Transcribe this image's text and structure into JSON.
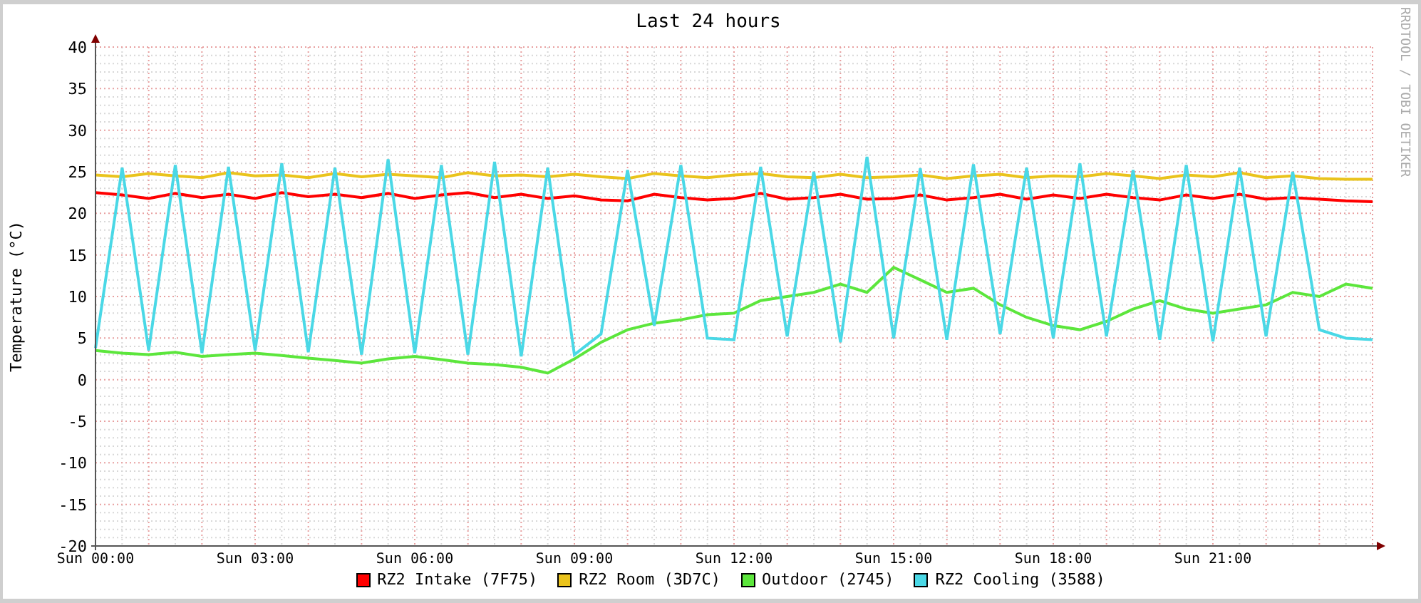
{
  "graph": {
    "credit": "RRDTOOL / TOBI OETIKER",
    "chart_data": {
      "type": "line",
      "grid": true,
      "title": "Last 24 hours",
      "ylabel": "Temperature (°C)",
      "ylim": [
        -20,
        40
      ],
      "yticks": [
        -20,
        -15,
        -10,
        -5,
        0,
        5,
        10,
        15,
        20,
        25,
        30,
        35,
        40
      ],
      "categories": [
        "Sun 00:00",
        null,
        null,
        null,
        null,
        null,
        "Sun 03:00",
        null,
        null,
        null,
        null,
        null,
        "Sun 06:00",
        null,
        null,
        null,
        null,
        null,
        "Sun 09:00",
        null,
        null,
        null,
        null,
        null,
        "Sun 12:00",
        null,
        null,
        null,
        null,
        null,
        "Sun 15:00",
        null,
        null,
        null,
        null,
        null,
        "Sun 18:00",
        null,
        null,
        null,
        null,
        null,
        "Sun 21:00",
        null,
        null,
        null,
        null,
        null,
        null
      ],
      "series": [
        {
          "name": "RZ2 Intake (7F75)",
          "color": "#ff0000",
          "values": [
            22.5,
            22.2,
            21.8,
            22.4,
            21.9,
            22.3,
            21.8,
            22.5,
            22.0,
            22.3,
            21.9,
            22.4,
            21.8,
            22.2,
            22.5,
            21.9,
            22.3,
            21.8,
            22.1,
            21.6,
            21.5,
            22.3,
            21.9,
            21.6,
            21.8,
            22.4,
            21.7,
            21.9,
            22.3,
            21.7,
            21.8,
            22.2,
            21.6,
            21.9,
            22.3,
            21.7,
            22.2,
            21.8,
            22.3,
            21.9,
            21.6,
            22.2,
            21.8,
            22.3,
            21.7,
            21.9,
            21.7,
            21.5,
            21.4
          ]
        },
        {
          "name": "RZ2 Room (3D7C)",
          "color": "#eac31c",
          "values": [
            24.6,
            24.4,
            24.8,
            24.5,
            24.3,
            24.9,
            24.5,
            24.6,
            24.3,
            24.8,
            24.4,
            24.7,
            24.5,
            24.3,
            24.9,
            24.5,
            24.6,
            24.4,
            24.7,
            24.4,
            24.2,
            24.8,
            24.5,
            24.3,
            24.6,
            24.8,
            24.4,
            24.3,
            24.7,
            24.3,
            24.4,
            24.6,
            24.2,
            24.5,
            24.7,
            24.3,
            24.5,
            24.4,
            24.8,
            24.5,
            24.2,
            24.6,
            24.4,
            24.9,
            24.3,
            24.5,
            24.2,
            24.1,
            24.1
          ]
        },
        {
          "name": "Outdoor (2745)",
          "color": "#5ce63c",
          "values": [
            3.5,
            3.2,
            3.0,
            3.3,
            2.8,
            3.0,
            3.2,
            2.9,
            2.6,
            2.3,
            2.0,
            2.5,
            2.8,
            2.4,
            2.0,
            1.8,
            1.5,
            0.8,
            2.5,
            4.5,
            6.0,
            6.8,
            7.2,
            7.8,
            8.0,
            9.5,
            10.0,
            10.5,
            11.5,
            10.5,
            13.5,
            12.0,
            10.5,
            11.0,
            9.0,
            7.5,
            6.5,
            6.0,
            7.0,
            8.5,
            9.5,
            8.5,
            8.0,
            8.5,
            9.0,
            10.5,
            10.0,
            11.5,
            11.0
          ]
        },
        {
          "name": "RZ2 Cooling (3588)",
          "color": "#4ad8e6",
          "values": [
            3.8,
            25.5,
            3.5,
            25.8,
            3.2,
            25.6,
            3.5,
            26.0,
            3.3,
            25.5,
            3.0,
            26.5,
            3.2,
            25.8,
            3.0,
            26.2,
            2.8,
            25.5,
            3.0,
            5.5,
            25.2,
            6.5,
            25.8,
            5.0,
            4.8,
            25.6,
            5.2,
            25.0,
            4.5,
            26.8,
            5.0,
            25.4,
            4.8,
            25.9,
            5.5,
            25.5,
            5.0,
            26.0,
            5.2,
            25.2,
            4.8,
            25.8,
            4.6,
            25.5,
            5.2,
            25.0,
            6.0,
            5.0,
            4.8
          ]
        }
      ]
    }
  }
}
